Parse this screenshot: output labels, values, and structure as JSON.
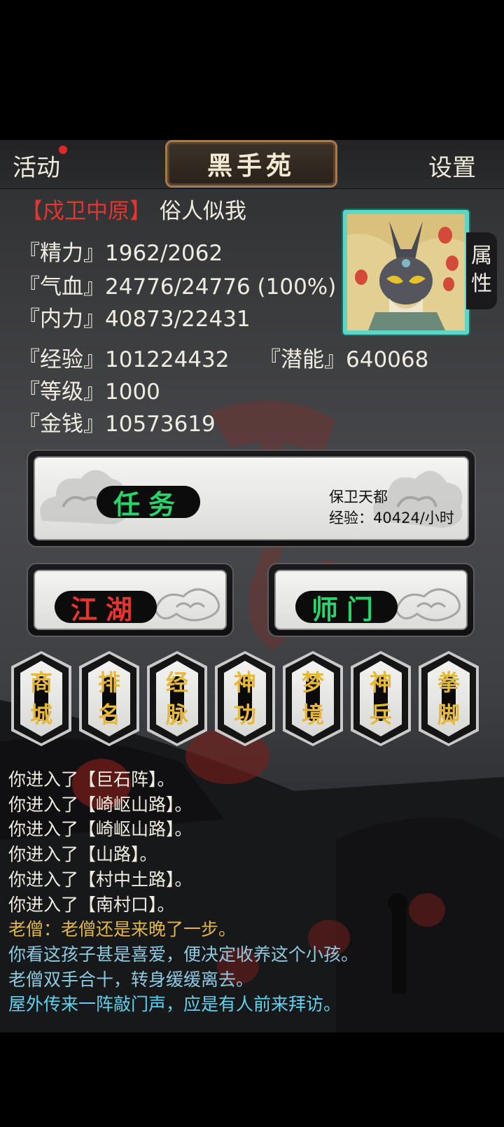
{
  "header": {
    "activity_label": "活动",
    "title": "黑手苑",
    "settings_label": "设置"
  },
  "character": {
    "faction": "【戍卫中原】",
    "name": "俗人似我",
    "stats": {
      "jingli": "『精力』1962/2062",
      "qixue": "『气血』24776/24776 (100%)",
      "neili": "『内力』40873/22431",
      "jingyan": "『经验』101224432",
      "qianneng": "『潜能』640068",
      "dengji": "『等级』1000",
      "jinqian": "『金钱』10573619"
    },
    "attr_tab": [
      "属",
      "性"
    ]
  },
  "quest": {
    "label": "任务",
    "info_title": "保卫天都",
    "info_exp": "经验：40424/小时"
  },
  "jianghu": {
    "label": "江湖"
  },
  "shimen": {
    "label": "师门"
  },
  "menu": [
    {
      "top": "商",
      "bottom": "城"
    },
    {
      "top": "排",
      "bottom": "名"
    },
    {
      "top": "经",
      "bottom": "脉"
    },
    {
      "top": "神",
      "bottom": "功"
    },
    {
      "top": "梦",
      "bottom": "境"
    },
    {
      "top": "神",
      "bottom": "兵"
    },
    {
      "top": "拳",
      "bottom": "脚"
    }
  ],
  "log": [
    {
      "text": "你进入了【巨石阵】。",
      "color": "#f0ece2"
    },
    {
      "text": "你进入了【崎岖山路】。",
      "color": "#f0ece2"
    },
    {
      "text": "你进入了【崎岖山路】。",
      "color": "#f0ece2"
    },
    {
      "text": "你进入了【山路】。",
      "color": "#f0ece2"
    },
    {
      "text": "你进入了【村中土路】。",
      "color": "#f0ece2"
    },
    {
      "text": "你进入了【南村口】。",
      "color": "#f0ece2"
    },
    {
      "text": "老僧：老僧还是来晚了一步。",
      "color": "#e0b64a"
    },
    {
      "text": "你看这孩子甚是喜爱，便决定收养这个小孩。",
      "color": "#8fc9e0"
    },
    {
      "text": "老僧双手合十，转身缓缓离去。",
      "color": "#8fc9e0"
    },
    {
      "text": "屋外传来一阵敲门声，应是有人前来拜访。",
      "color": "#5fd2f0"
    }
  ],
  "colors": {
    "faction_red": "#e5352e",
    "quest_green": "#2bd46a",
    "menu_gold": "#e6b83a",
    "portrait_border": "#5fd6c5"
  }
}
